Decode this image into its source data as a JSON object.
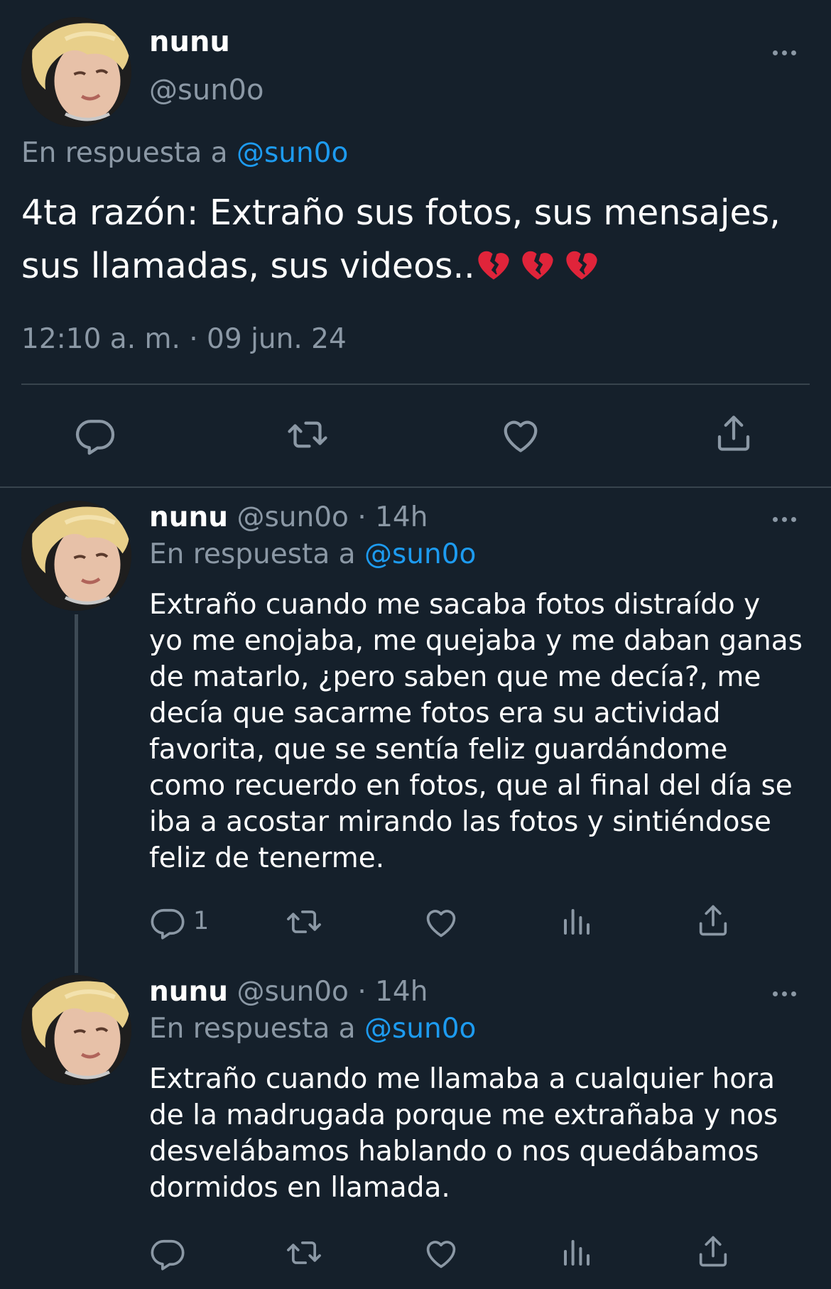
{
  "main_tweet": {
    "author_name": "nunu",
    "author_handle": "@sun0o",
    "reply_prefix": "En respuesta a",
    "reply_to": "@sun0o",
    "text": "4ta razón: Extraño sus fotos, sus mensajes, sus llamadas, sus videos..",
    "emojis": [
      "broken-heart",
      "broken-heart",
      "broken-heart"
    ],
    "timestamp": "12:10 a. m. · 09 jun. 24"
  },
  "replies": [
    {
      "author_name": "nunu",
      "author_handle": "@sun0o",
      "time": "· 14h",
      "reply_prefix": "En respuesta a",
      "reply_to": "@sun0o",
      "lines": [
        "Extraño cuando me sacaba fotos distraído y",
        "yo me enojaba, me quejaba y me daban ganas",
        "de matarlo, ¿pero saben que me decía?, me",
        "decía que sacarme fotos era su actividad",
        "favorita, que se sentía feliz guardándome",
        "como recuerdo en fotos, que al final del día se",
        "iba a acostar mirando las fotos y sintiéndose",
        "feliz de tenerme."
      ],
      "reply_count": "1"
    },
    {
      "author_name": "nunu",
      "author_handle": "@sun0o",
      "time": "· 14h",
      "reply_prefix": "En respuesta a",
      "reply_to": "@sun0o",
      "lines": [
        "Extraño cuando me llamaba a cualquier hora",
        "de la madrugada porque me extrañaba y nos",
        "desvelábamos hablando o nos quedábamos",
        "dormidos en llamada."
      ],
      "reply_count": ""
    }
  ],
  "icons": {
    "reply": "reply-icon",
    "retweet": "retweet-icon",
    "like": "like-icon",
    "views": "views-icon",
    "share": "share-icon",
    "more": "more-icon"
  },
  "colors": {
    "background": "#15202b",
    "text": "#ffffff",
    "muted": "#8b98a5",
    "link": "#1d9bf0",
    "divider": "#38444d",
    "broken_heart": "#e0243a"
  }
}
